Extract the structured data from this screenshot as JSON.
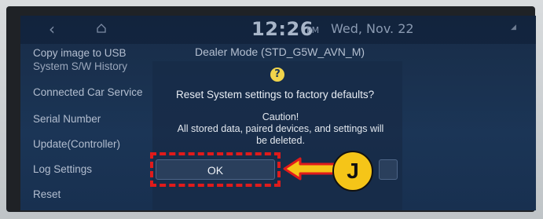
{
  "topbar": {
    "time": "12:26",
    "ampm": "PM",
    "date": "Wed, Nov. 22",
    "back_icon": "back-icon",
    "home_icon": "home-icon"
  },
  "side_menu": {
    "items": [
      {
        "label": "Copy image to USB"
      },
      {
        "label": "System S/W History"
      },
      {
        "label": "Connected Car Service"
      },
      {
        "label": "Serial Number"
      },
      {
        "label": "Update(Controller)"
      },
      {
        "label": "Log Settings"
      },
      {
        "label": "Reset"
      }
    ]
  },
  "main": {
    "title": "Dealer Mode (STD_G5W_AVN_M)"
  },
  "dialog": {
    "icon": "question-icon",
    "question": "Reset System settings to factory defaults?",
    "caution_title": "Caution!",
    "caution_line1": "All stored data, paired devices, and settings will",
    "caution_line2": "be deleted.",
    "ok_label": "OK"
  },
  "annotation": {
    "callout_label": "J",
    "highlight_color": "#e01b1b",
    "callout_color": "#f5c518"
  }
}
